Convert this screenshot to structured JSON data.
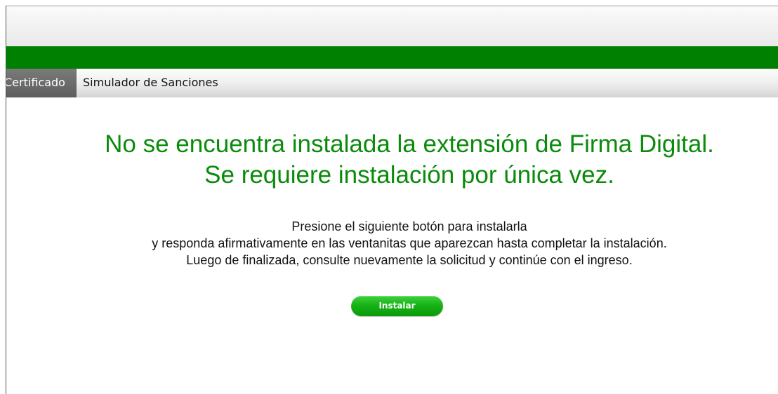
{
  "menu": {
    "items": [
      {
        "label": "Certificado",
        "active": true
      },
      {
        "label": "Simulador de Sanciones",
        "active": false
      }
    ]
  },
  "message": {
    "title_line1": "No se encuentra instalada la extensión de Firma Digital.",
    "title_line2": "Se requiere instalación por única vez.",
    "instruction_line1": "Presione el siguiente botón para instalarla",
    "instruction_line2": "y responda afirmativamente en las ventanitas que aparezcan hasta completar la instalación.",
    "instruction_line3": "Luego de finalizada, consulte nuevamente la solicitud y continúe con el ingreso."
  },
  "install_button": {
    "label": "Instalar"
  },
  "colors": {
    "header_green": "#008000",
    "title_green": "#0b8b0b",
    "button_green": "#17b317",
    "active_tab": "#6a6a6a"
  }
}
